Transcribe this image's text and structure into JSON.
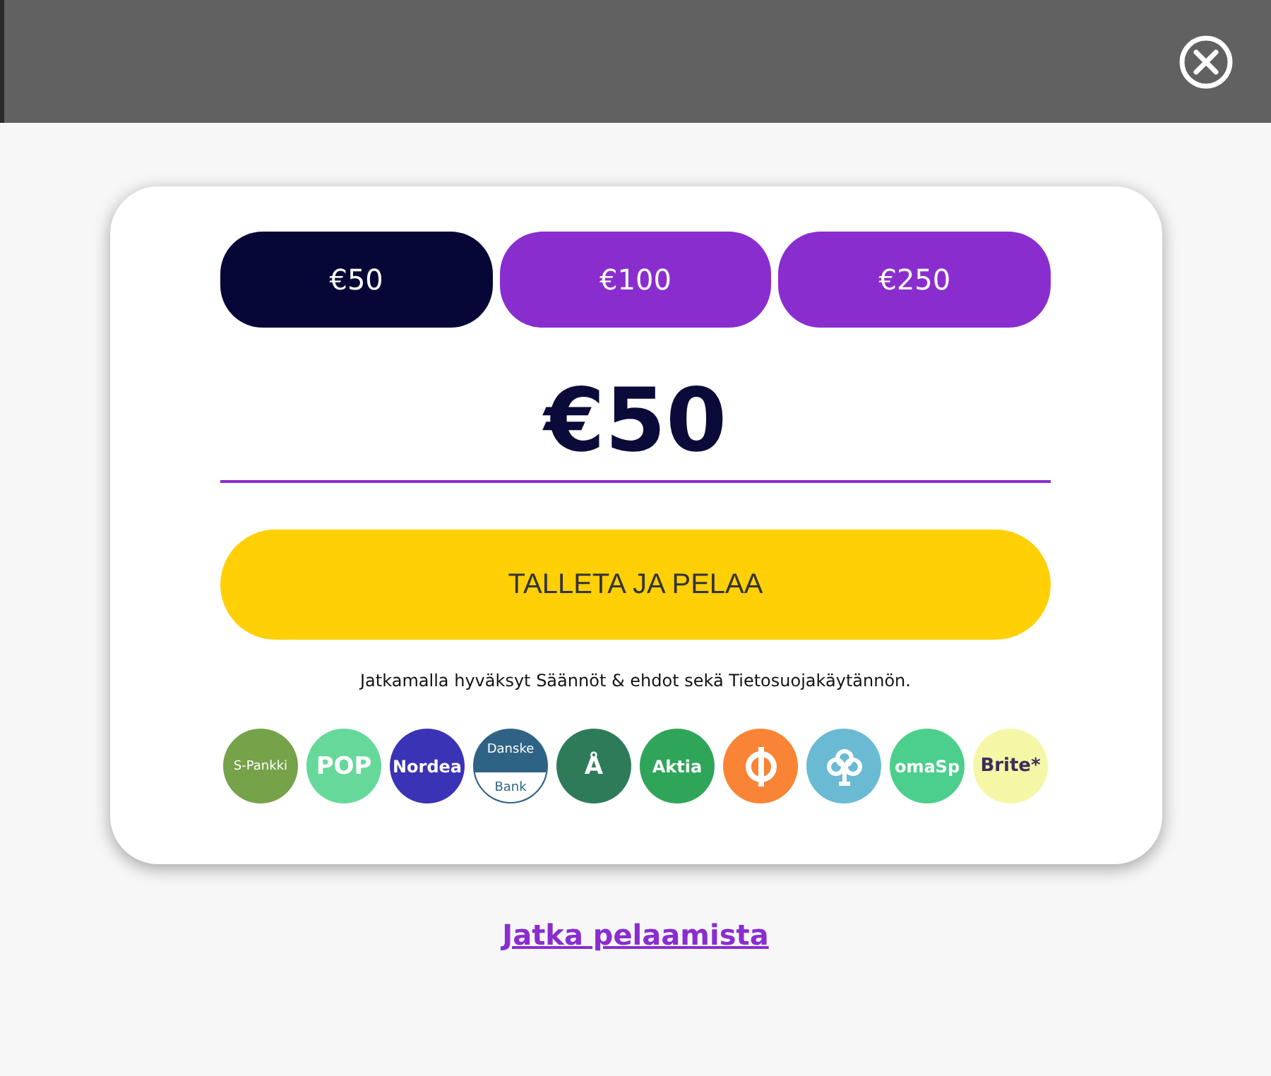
{
  "header": {
    "close_icon": true
  },
  "amounts": [
    {
      "label": "€50",
      "selected": true
    },
    {
      "label": "€100",
      "selected": false
    },
    {
      "label": "€250",
      "selected": false
    }
  ],
  "amount_value": "€50",
  "deposit_button": "TALLETA JA PELAA",
  "terms": "Jatkamalla hyväksyt Säännöt & ehdot sekä Tietosuojakäytännön.",
  "banks": [
    {
      "kind": "text",
      "text": "S-Pankki",
      "color": "#76a24a"
    },
    {
      "kind": "text",
      "text": "POP",
      "color": "#66d99a"
    },
    {
      "kind": "text",
      "text": "Nordea",
      "color": "#3a33b5"
    },
    {
      "kind": "split",
      "top": "Danske",
      "bottom": "Bank",
      "color": "#2f6386"
    },
    {
      "kind": "text",
      "text": "Å",
      "color": "#2e7b5a"
    },
    {
      "kind": "text",
      "text": "Aktia",
      "color": "#2fa55a"
    },
    {
      "kind": "op",
      "color": "#fa8435"
    },
    {
      "kind": "tree",
      "color": "#6bbad4"
    },
    {
      "kind": "text",
      "text": "omaSp",
      "color": "#4ccf8c"
    },
    {
      "kind": "dark",
      "text": "Brite*",
      "color": "#f5f7a6"
    }
  ],
  "continue_link": "Jatka pelaamista"
}
